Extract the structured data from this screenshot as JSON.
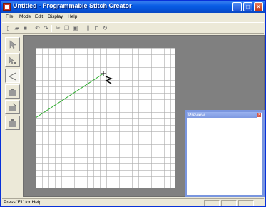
{
  "window": {
    "title": "Untitled - Programmable Stitch Creator",
    "controls": {
      "minimize": "_",
      "maximize": "□",
      "close": "×"
    }
  },
  "menu": [
    "File",
    "Mode",
    "Edit",
    "Display",
    "Help"
  ],
  "toolbar": {
    "icons": [
      "new-icon",
      "open-icon",
      "save-icon",
      "undo-icon",
      "redo-icon",
      "cut-icon",
      "copy-icon",
      "paste-icon",
      "mirror-icon",
      "tile-icon",
      "rotate-icon"
    ]
  },
  "palette": {
    "tools": [
      "select-tool",
      "select-point-tool",
      "stitch-tool",
      "fill-tool-1",
      "fill-tool-2",
      "fill-tool-3"
    ],
    "active": "stitch-tool"
  },
  "preview": {
    "title": "Preview",
    "close": "×"
  },
  "status": {
    "text": "Press 'F1' for Help"
  },
  "colors": {
    "stitch_line": "#2fae2f",
    "title_bar": "#0553d8",
    "preview_border": "#7a96df"
  }
}
